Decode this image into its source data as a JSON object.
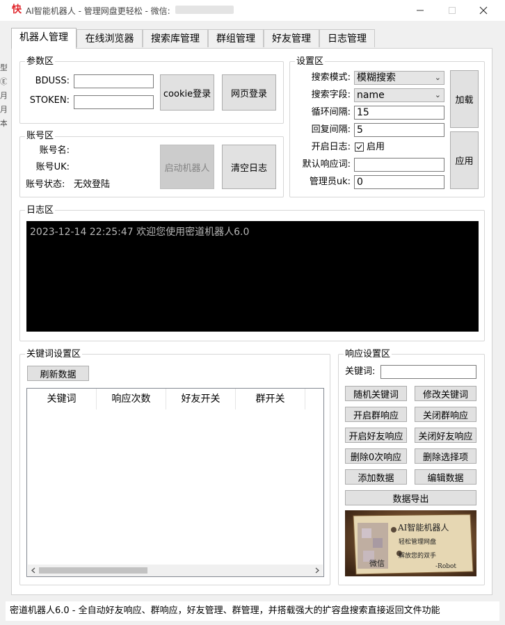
{
  "window": {
    "app_icon_glyph": "快",
    "title": "AI智能机器人 - 管理网盘更轻松 - 微信:",
    "minimize_glyph": "—",
    "maximize_glyph": "☐",
    "close_glyph": "✕"
  },
  "bg_strip": [
    "型",
    "Ⓔ",
    "月",
    "月",
    "本"
  ],
  "tabs": [
    "机器人管理",
    "在线浏览器",
    "搜索库管理",
    "群组管理",
    "好友管理",
    "日志管理"
  ],
  "params": {
    "title": "参数区",
    "bduss_label": "BDUSS:",
    "stoken_label": "STOKEN:",
    "bduss_value": "",
    "stoken_value": "",
    "cookie_login": "cookie登录",
    "web_login": "网页登录"
  },
  "account": {
    "title": "账号区",
    "name_label": "账号名:",
    "uk_label": "账号UK:",
    "status_label": "账号状态:",
    "status_value": "无效登陆",
    "start_robot": "启动机器人",
    "clear_log": "清空日志"
  },
  "settings": {
    "title": "设置区",
    "search_mode_label": "搜索模式:",
    "search_mode_value": "模糊搜索",
    "search_field_label": "搜索字段:",
    "search_field_value": "name",
    "loop_interval_label": "循环间隔:",
    "loop_interval_value": "15",
    "reply_interval_label": "回复间隔:",
    "reply_interval_value": "5",
    "log_enable_label": "开启日志:",
    "log_enable_checked": true,
    "log_enable_option": "启用",
    "default_reply_label": "默认响应词:",
    "default_reply_value": "",
    "admin_uk_label": "管理员uk:",
    "admin_uk_value": "0",
    "load": "加载",
    "apply": "应用"
  },
  "log": {
    "title": "日志区",
    "lines": [
      "2023-12-14 22:25:47 欢迎您使用密道机器人6.0"
    ]
  },
  "keywords": {
    "title": "关键词设置区",
    "refresh": "刷新数据",
    "columns": [
      "关键词",
      "响应次数",
      "好友开关",
      "群开关"
    ],
    "rows": []
  },
  "response": {
    "title": "响应设置区",
    "keyword_label": "关键词:",
    "keyword_value": "",
    "buttons": {
      "random_keyword": "随机关键词",
      "edit_keyword": "修改关键词",
      "enable_group": "开启群响应",
      "disable_group": "关闭群响应",
      "enable_friend": "开启好友响应",
      "disable_friend": "关闭好友响应",
      "delete_zero": "删除0次响应",
      "delete_selected": "删除选择项",
      "add_data": "添加数据",
      "edit_data": "编辑数据",
      "export_data": "数据导出"
    }
  },
  "ad": {
    "title": "AI智能机器人",
    "line1": "轻松管理网盘",
    "line2": "解放您的双手",
    "signature": "-Robot",
    "wechat": "微信"
  },
  "status_bar": "密道机器人6.0 - 全自动好友响应、群响应，好友管理、群管理，并搭载强大的扩容盘搜索直接返回文件功能"
}
